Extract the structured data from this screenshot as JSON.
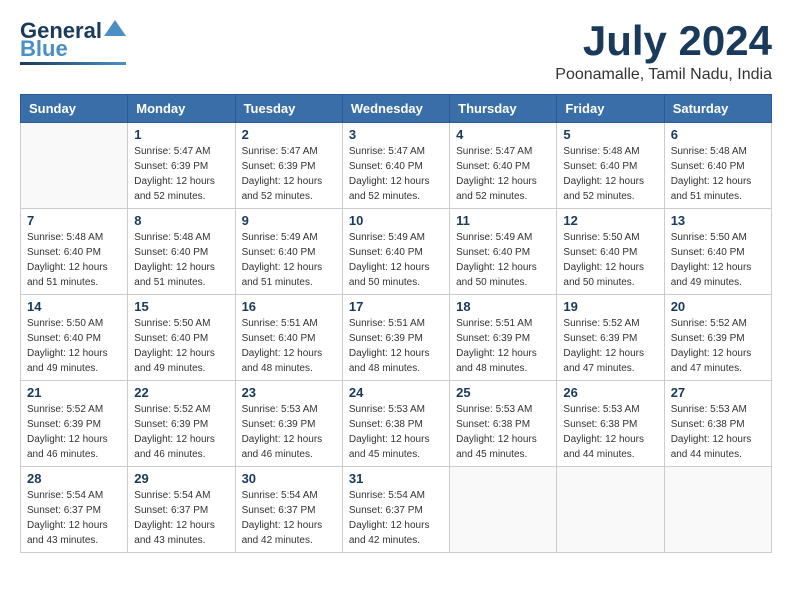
{
  "logo": {
    "general": "General",
    "blue": "Blue",
    "bird_symbol": "▲"
  },
  "title": {
    "month_year": "July 2024",
    "location": "Poonamalle, Tamil Nadu, India"
  },
  "headers": [
    "Sunday",
    "Monday",
    "Tuesday",
    "Wednesday",
    "Thursday",
    "Friday",
    "Saturday"
  ],
  "weeks": [
    [
      {
        "day": "",
        "sunrise": "",
        "sunset": "",
        "daylight": ""
      },
      {
        "day": "1",
        "sunrise": "Sunrise: 5:47 AM",
        "sunset": "Sunset: 6:39 PM",
        "daylight": "Daylight: 12 hours and 52 minutes."
      },
      {
        "day": "2",
        "sunrise": "Sunrise: 5:47 AM",
        "sunset": "Sunset: 6:39 PM",
        "daylight": "Daylight: 12 hours and 52 minutes."
      },
      {
        "day": "3",
        "sunrise": "Sunrise: 5:47 AM",
        "sunset": "Sunset: 6:40 PM",
        "daylight": "Daylight: 12 hours and 52 minutes."
      },
      {
        "day": "4",
        "sunrise": "Sunrise: 5:47 AM",
        "sunset": "Sunset: 6:40 PM",
        "daylight": "Daylight: 12 hours and 52 minutes."
      },
      {
        "day": "5",
        "sunrise": "Sunrise: 5:48 AM",
        "sunset": "Sunset: 6:40 PM",
        "daylight": "Daylight: 12 hours and 52 minutes."
      },
      {
        "day": "6",
        "sunrise": "Sunrise: 5:48 AM",
        "sunset": "Sunset: 6:40 PM",
        "daylight": "Daylight: 12 hours and 51 minutes."
      }
    ],
    [
      {
        "day": "7",
        "sunrise": "Sunrise: 5:48 AM",
        "sunset": "Sunset: 6:40 PM",
        "daylight": "Daylight: 12 hours and 51 minutes."
      },
      {
        "day": "8",
        "sunrise": "Sunrise: 5:48 AM",
        "sunset": "Sunset: 6:40 PM",
        "daylight": "Daylight: 12 hours and 51 minutes."
      },
      {
        "day": "9",
        "sunrise": "Sunrise: 5:49 AM",
        "sunset": "Sunset: 6:40 PM",
        "daylight": "Daylight: 12 hours and 51 minutes."
      },
      {
        "day": "10",
        "sunrise": "Sunrise: 5:49 AM",
        "sunset": "Sunset: 6:40 PM",
        "daylight": "Daylight: 12 hours and 50 minutes."
      },
      {
        "day": "11",
        "sunrise": "Sunrise: 5:49 AM",
        "sunset": "Sunset: 6:40 PM",
        "daylight": "Daylight: 12 hours and 50 minutes."
      },
      {
        "day": "12",
        "sunrise": "Sunrise: 5:50 AM",
        "sunset": "Sunset: 6:40 PM",
        "daylight": "Daylight: 12 hours and 50 minutes."
      },
      {
        "day": "13",
        "sunrise": "Sunrise: 5:50 AM",
        "sunset": "Sunset: 6:40 PM",
        "daylight": "Daylight: 12 hours and 49 minutes."
      }
    ],
    [
      {
        "day": "14",
        "sunrise": "Sunrise: 5:50 AM",
        "sunset": "Sunset: 6:40 PM",
        "daylight": "Daylight: 12 hours and 49 minutes."
      },
      {
        "day": "15",
        "sunrise": "Sunrise: 5:50 AM",
        "sunset": "Sunset: 6:40 PM",
        "daylight": "Daylight: 12 hours and 49 minutes."
      },
      {
        "day": "16",
        "sunrise": "Sunrise: 5:51 AM",
        "sunset": "Sunset: 6:40 PM",
        "daylight": "Daylight: 12 hours and 48 minutes."
      },
      {
        "day": "17",
        "sunrise": "Sunrise: 5:51 AM",
        "sunset": "Sunset: 6:39 PM",
        "daylight": "Daylight: 12 hours and 48 minutes."
      },
      {
        "day": "18",
        "sunrise": "Sunrise: 5:51 AM",
        "sunset": "Sunset: 6:39 PM",
        "daylight": "Daylight: 12 hours and 48 minutes."
      },
      {
        "day": "19",
        "sunrise": "Sunrise: 5:52 AM",
        "sunset": "Sunset: 6:39 PM",
        "daylight": "Daylight: 12 hours and 47 minutes."
      },
      {
        "day": "20",
        "sunrise": "Sunrise: 5:52 AM",
        "sunset": "Sunset: 6:39 PM",
        "daylight": "Daylight: 12 hours and 47 minutes."
      }
    ],
    [
      {
        "day": "21",
        "sunrise": "Sunrise: 5:52 AM",
        "sunset": "Sunset: 6:39 PM",
        "daylight": "Daylight: 12 hours and 46 minutes."
      },
      {
        "day": "22",
        "sunrise": "Sunrise: 5:52 AM",
        "sunset": "Sunset: 6:39 PM",
        "daylight": "Daylight: 12 hours and 46 minutes."
      },
      {
        "day": "23",
        "sunrise": "Sunrise: 5:53 AM",
        "sunset": "Sunset: 6:39 PM",
        "daylight": "Daylight: 12 hours and 46 minutes."
      },
      {
        "day": "24",
        "sunrise": "Sunrise: 5:53 AM",
        "sunset": "Sunset: 6:38 PM",
        "daylight": "Daylight: 12 hours and 45 minutes."
      },
      {
        "day": "25",
        "sunrise": "Sunrise: 5:53 AM",
        "sunset": "Sunset: 6:38 PM",
        "daylight": "Daylight: 12 hours and 45 minutes."
      },
      {
        "day": "26",
        "sunrise": "Sunrise: 5:53 AM",
        "sunset": "Sunset: 6:38 PM",
        "daylight": "Daylight: 12 hours and 44 minutes."
      },
      {
        "day": "27",
        "sunrise": "Sunrise: 5:53 AM",
        "sunset": "Sunset: 6:38 PM",
        "daylight": "Daylight: 12 hours and 44 minutes."
      }
    ],
    [
      {
        "day": "28",
        "sunrise": "Sunrise: 5:54 AM",
        "sunset": "Sunset: 6:37 PM",
        "daylight": "Daylight: 12 hours and 43 minutes."
      },
      {
        "day": "29",
        "sunrise": "Sunrise: 5:54 AM",
        "sunset": "Sunset: 6:37 PM",
        "daylight": "Daylight: 12 hours and 43 minutes."
      },
      {
        "day": "30",
        "sunrise": "Sunrise: 5:54 AM",
        "sunset": "Sunset: 6:37 PM",
        "daylight": "Daylight: 12 hours and 42 minutes."
      },
      {
        "day": "31",
        "sunrise": "Sunrise: 5:54 AM",
        "sunset": "Sunset: 6:37 PM",
        "daylight": "Daylight: 12 hours and 42 minutes."
      },
      {
        "day": "",
        "sunrise": "",
        "sunset": "",
        "daylight": ""
      },
      {
        "day": "",
        "sunrise": "",
        "sunset": "",
        "daylight": ""
      },
      {
        "day": "",
        "sunrise": "",
        "sunset": "",
        "daylight": ""
      }
    ]
  ]
}
